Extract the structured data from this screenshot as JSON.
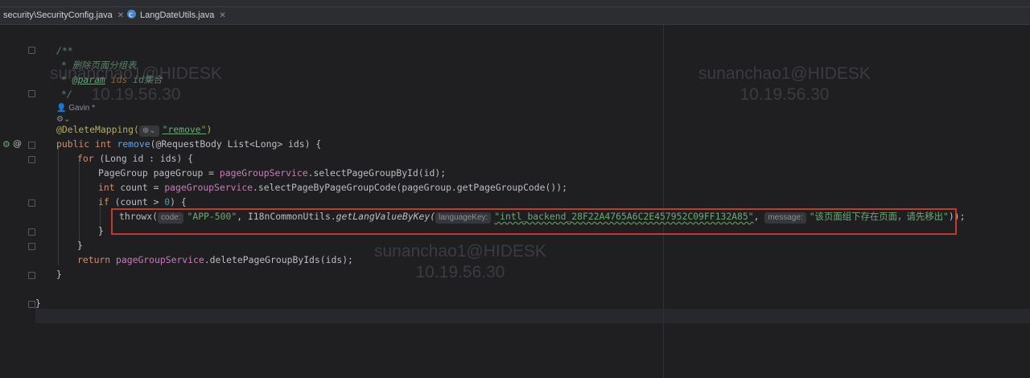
{
  "tabs": [
    {
      "label": "security\\SecurityConfig.java",
      "active": false
    },
    {
      "label": "LangDateUtils.java",
      "active": false
    }
  ],
  "watermarks": [
    {
      "user": "sunanchao1@HIDESK",
      "ip": "10.19.56.30"
    },
    {
      "user": "sunanchao1@HIDESK",
      "ip": "10.19.56.30"
    },
    {
      "user": "sunanchao1@HIDESK",
      "ip": "10.19.56.30"
    }
  ],
  "code": {
    "doc_open": "/**",
    "doc_line1": "* 删除页面分组表",
    "doc_param_tag": "@param",
    "doc_param_name": "ids",
    "doc_param_desc": "id集合",
    "doc_close": "*/",
    "author": "Gavin *",
    "annotation": "@DeleteMapping(",
    "mapping_value": "\"remove\"",
    "annotation_close": ")",
    "public_kw": "public",
    "int_kw": "int",
    "method_name": "remove",
    "params": "(@RequestBody List<Long> ids) {",
    "for_kw": "for",
    "for_rest": " (Long id : ids) {",
    "pg_decl": "PageGroup pageGroup = ",
    "pg_service": "pageGroupService",
    "pg_call": ".selectPageGroupById(id);",
    "count_decl": " count = ",
    "count_service": "pageGroupService",
    "count_call": ".selectPageByPageGroupCode(pageGroup.getPageGroupCode());",
    "if_kw": "if",
    "if_cond_a": " (count > ",
    "if_zero": "0",
    "if_cond_b": ") {",
    "throw_fn": "throwx(",
    "hint_code": "code:",
    "code_value": "\"APP-500\"",
    "utils_class": ", I18nCommonUtils.",
    "utils_method": "getLangValueByKey(",
    "hint_langkey": "languageKey:",
    "langkey_value": "\"intl_backend_28F22A4765A6C2E457952C09FF132A85\"",
    "comma": ",",
    "hint_message": "message:",
    "message_value": "\"该页面组下存在页面，请先移出\"",
    "throw_close": "));",
    "brace": "}",
    "return_kw": "return",
    "return_service": "pageGroupService",
    "return_call": ".deletePageGroupByIds(ids);"
  }
}
